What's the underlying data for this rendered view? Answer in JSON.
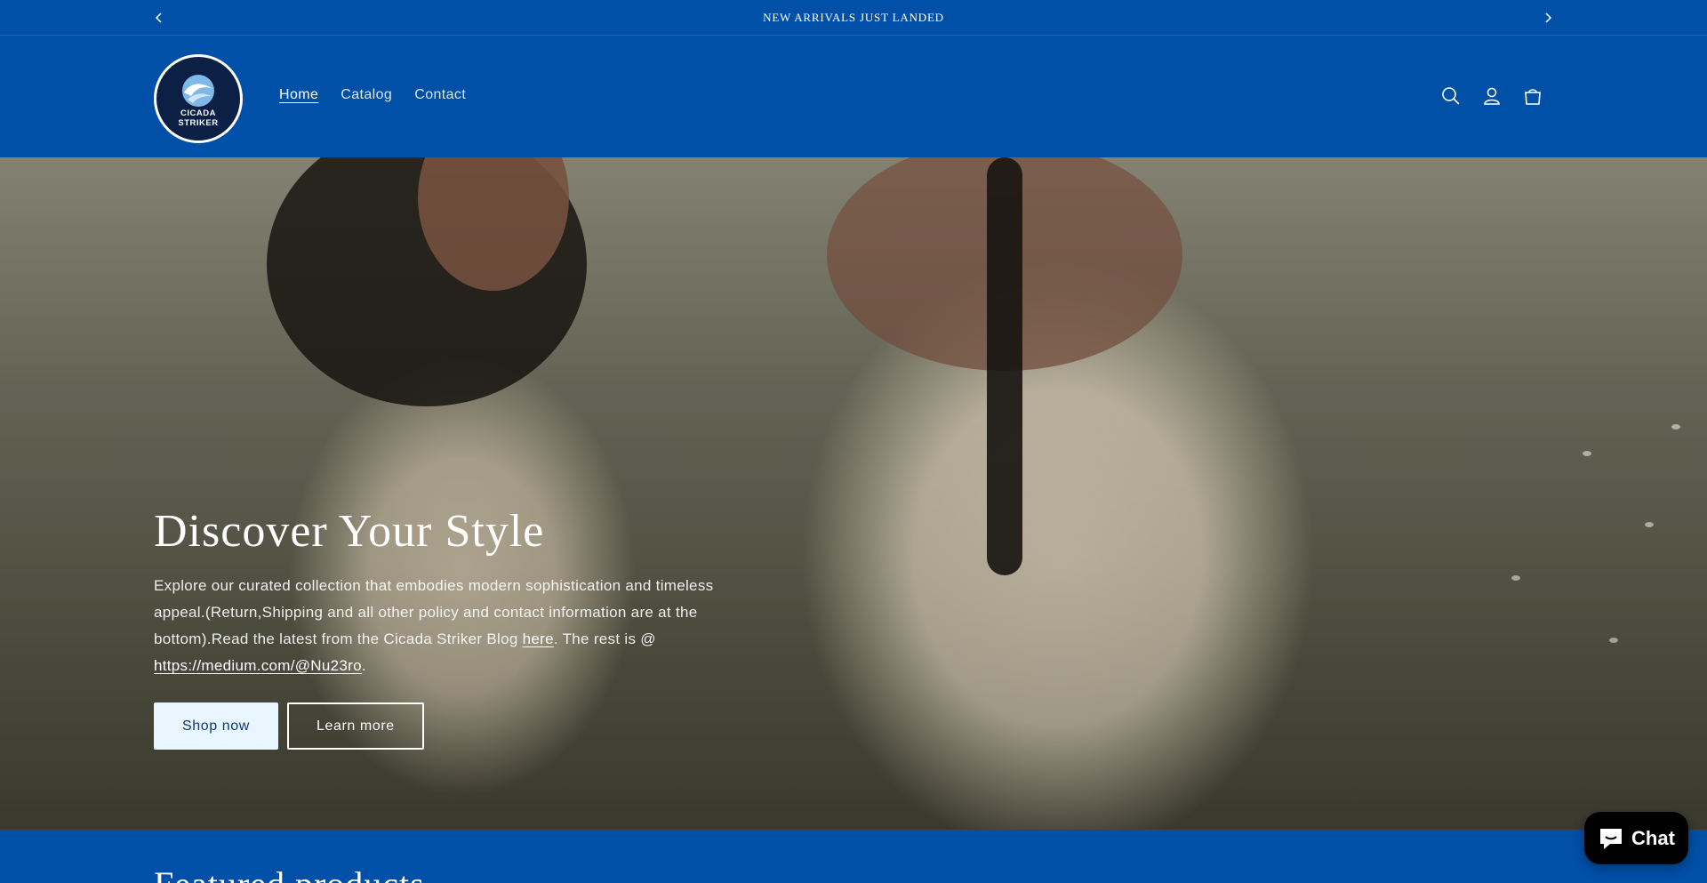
{
  "announcement": {
    "message": "NEW ARRIVALS JUST LANDED"
  },
  "header": {
    "logo_text": "CICADA\nSTRIKER",
    "nav": [
      {
        "label": "Home",
        "active": true
      },
      {
        "label": "Catalog",
        "active": false
      },
      {
        "label": "Contact",
        "active": false
      }
    ],
    "icons": [
      "search-icon",
      "account-icon",
      "cart-icon"
    ]
  },
  "hero": {
    "title": "Discover Your Style",
    "text_before": "Explore our curated collection that embodies modern sophistication and timeless appeal.(Return,Shipping and all other policy and contact information are at the bottom).Read the latest from the Cicada Striker Blog ",
    "link_here": "here",
    "text_middle": ". The rest is @ ",
    "link_medium": "https://medium.com/@Nu23ro",
    "text_after": ".",
    "primary_button": "Shop now",
    "secondary_button": "Learn more"
  },
  "featured": {
    "title": "Featured products"
  },
  "chat": {
    "label": "Chat"
  },
  "colors": {
    "brand_blue": "#0050a8",
    "button_light": "#e9f5ff",
    "chat_bg": "#000000"
  }
}
